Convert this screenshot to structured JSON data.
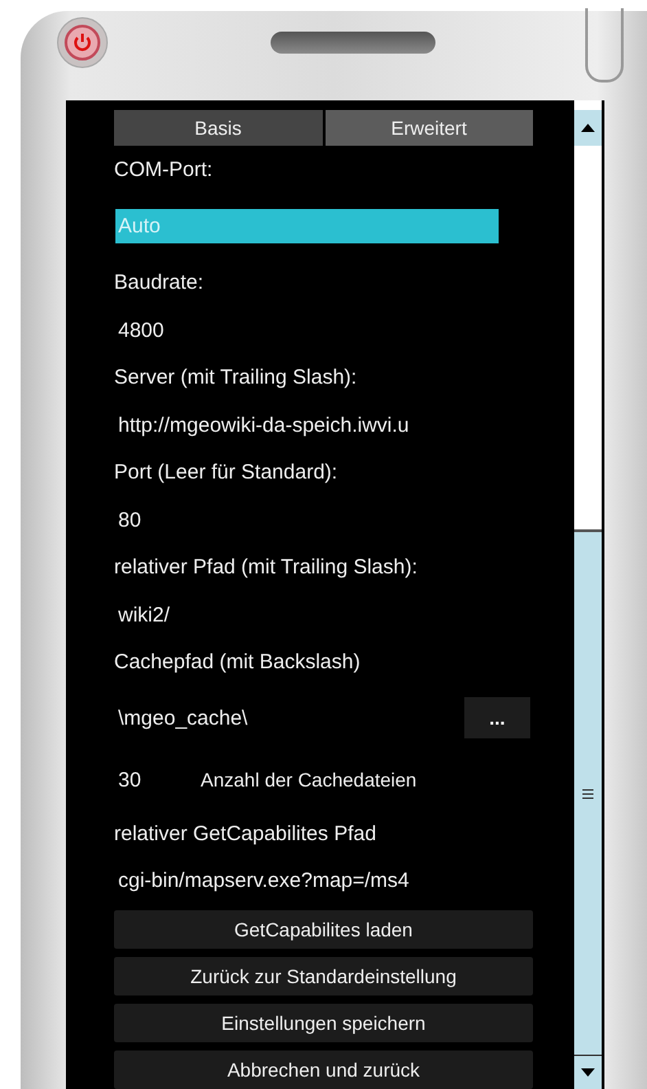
{
  "tabs": [
    {
      "label": "Basis",
      "selected": false
    },
    {
      "label": "Erweitert",
      "selected": true
    }
  ],
  "fields": [
    {
      "kind": "label",
      "text": "COM-Port:"
    },
    {
      "kind": "combo",
      "value": "Auto",
      "focused": true
    },
    {
      "kind": "label",
      "text": "Baudrate:"
    },
    {
      "kind": "value",
      "value": "4800"
    },
    {
      "kind": "label",
      "text": "Server (mit Trailing Slash):"
    },
    {
      "kind": "value",
      "value": "http://mgeowiki-da-speich.iwvi.u"
    },
    {
      "kind": "label",
      "text": "Port (Leer für Standard):"
    },
    {
      "kind": "value",
      "value": "80"
    },
    {
      "kind": "label",
      "text": "relativer Pfad (mit Trailing Slash):"
    },
    {
      "kind": "value",
      "value": "wiki2/"
    },
    {
      "kind": "label",
      "text": "Cachepfad (mit Backslash)"
    },
    {
      "kind": "browse",
      "value": "\\mgeo_cache\\",
      "button": "..."
    },
    {
      "kind": "count",
      "value": "30",
      "label": "Anzahl der Cachedateien"
    },
    {
      "kind": "label",
      "text": "relativer GetCapabilites Pfad"
    },
    {
      "kind": "value",
      "value": "cgi-bin/mapserv.exe?map=/ms4"
    }
  ],
  "buttons": [
    "GetCapabilites laden",
    "Zurück zur Standardeinstellung",
    "Einstellungen speichern",
    "Abbrechen und zurück"
  ]
}
